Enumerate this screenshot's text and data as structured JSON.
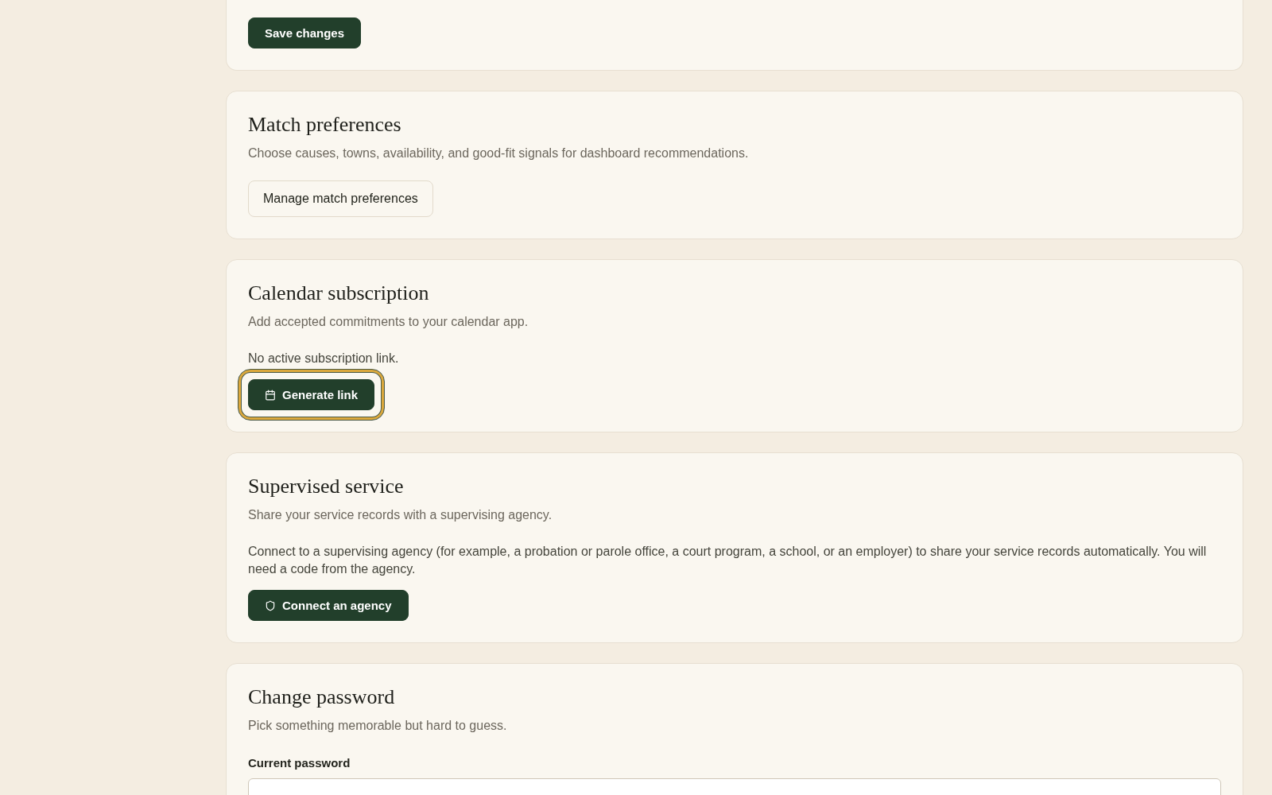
{
  "sections": [
    {
      "kind": "actions",
      "buttons": [
        {
          "label": "Save changes",
          "kind": "primary"
        }
      ]
    },
    {
      "kind": "match",
      "title": "Match preferences",
      "description": "Choose causes, towns, availability, and good-fit signals for dashboard recommendations.",
      "buttons": [
        {
          "label": "Manage match preferences",
          "kind": "secondary"
        }
      ]
    },
    {
      "kind": "calendar",
      "title": "Calendar subscription",
      "description": "Add accepted commitments to your calendar app.",
      "text": "No active subscription link.",
      "buttons": [
        {
          "label": "Generate link",
          "kind": "primary",
          "focused": true
        }
      ]
    },
    {
      "kind": "agency",
      "title": "Supervised service",
      "description": "Share your service records with a supervising agency.",
      "text": "Connect to a supervising agency (for example, a probation or parole office, a court program, a school, or an employer) to share your service records automatically. You will need a code from the agency.",
      "buttons": [
        {
          "label": "Connect an agency",
          "kind": "primary"
        }
      ]
    },
    {
      "kind": "password",
      "title": "Change password",
      "description": "Pick something memorable but hard to guess.",
      "fields": [
        {
          "label": "Current password"
        }
      ]
    }
  ]
}
